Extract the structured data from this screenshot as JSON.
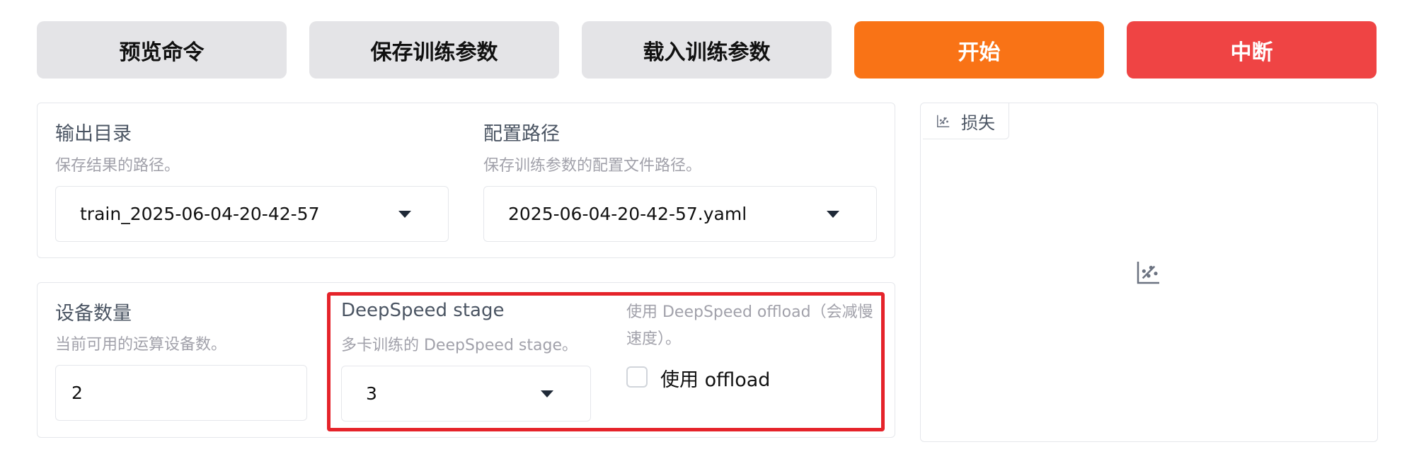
{
  "buttons": {
    "preview": "预览命令",
    "save": "保存训练参数",
    "load": "载入训练参数",
    "start": "开始",
    "abort": "中断"
  },
  "output_dir": {
    "label": "输出目录",
    "info": "保存结果的路径。",
    "value": "train_2025-06-04-20-42-57"
  },
  "config_path": {
    "label": "配置路径",
    "info": "保存训练参数的配置文件路径。",
    "value": "2025-06-04-20-42-57.yaml"
  },
  "device_count": {
    "label": "设备数量",
    "info": "当前可用的运算设备数。",
    "value": "2"
  },
  "ds_stage": {
    "label": "DeepSpeed stage",
    "info": "多卡训练的 DeepSpeed stage。",
    "value": "3"
  },
  "ds_offload": {
    "info": "使用 DeepSpeed offload（会减慢速度）。",
    "checkbox_label": "使用 offload",
    "checked": false
  },
  "loss_plot": {
    "tab_label": "损失"
  },
  "colors": {
    "start": "#f97316",
    "abort": "#ef4444",
    "highlight": "#e5232a"
  }
}
